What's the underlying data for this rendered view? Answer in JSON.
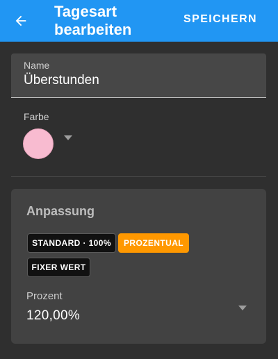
{
  "appbar": {
    "title_line1": "Tagesart",
    "title_line2": "bearbeiten",
    "save_label": "SPEICHERN",
    "back_icon": "arrow-left-icon",
    "background": "#2196f3"
  },
  "name_field": {
    "label": "Name",
    "value": "Überstunden"
  },
  "color_field": {
    "label": "Farbe",
    "selected_color": "#f8bbd0",
    "dropdown_icon": "caret-down-icon"
  },
  "adjustment": {
    "title": "Anpassung",
    "options": [
      {
        "label": "STANDARD · 100%",
        "selected": false
      },
      {
        "label": "PROZENTUAL",
        "selected": true
      },
      {
        "label": "FIXER WERT",
        "selected": false
      }
    ],
    "accent": "#ff9800",
    "percent_field": {
      "label": "Prozent",
      "value": "120,00%",
      "dropdown_icon": "caret-down-icon"
    }
  }
}
